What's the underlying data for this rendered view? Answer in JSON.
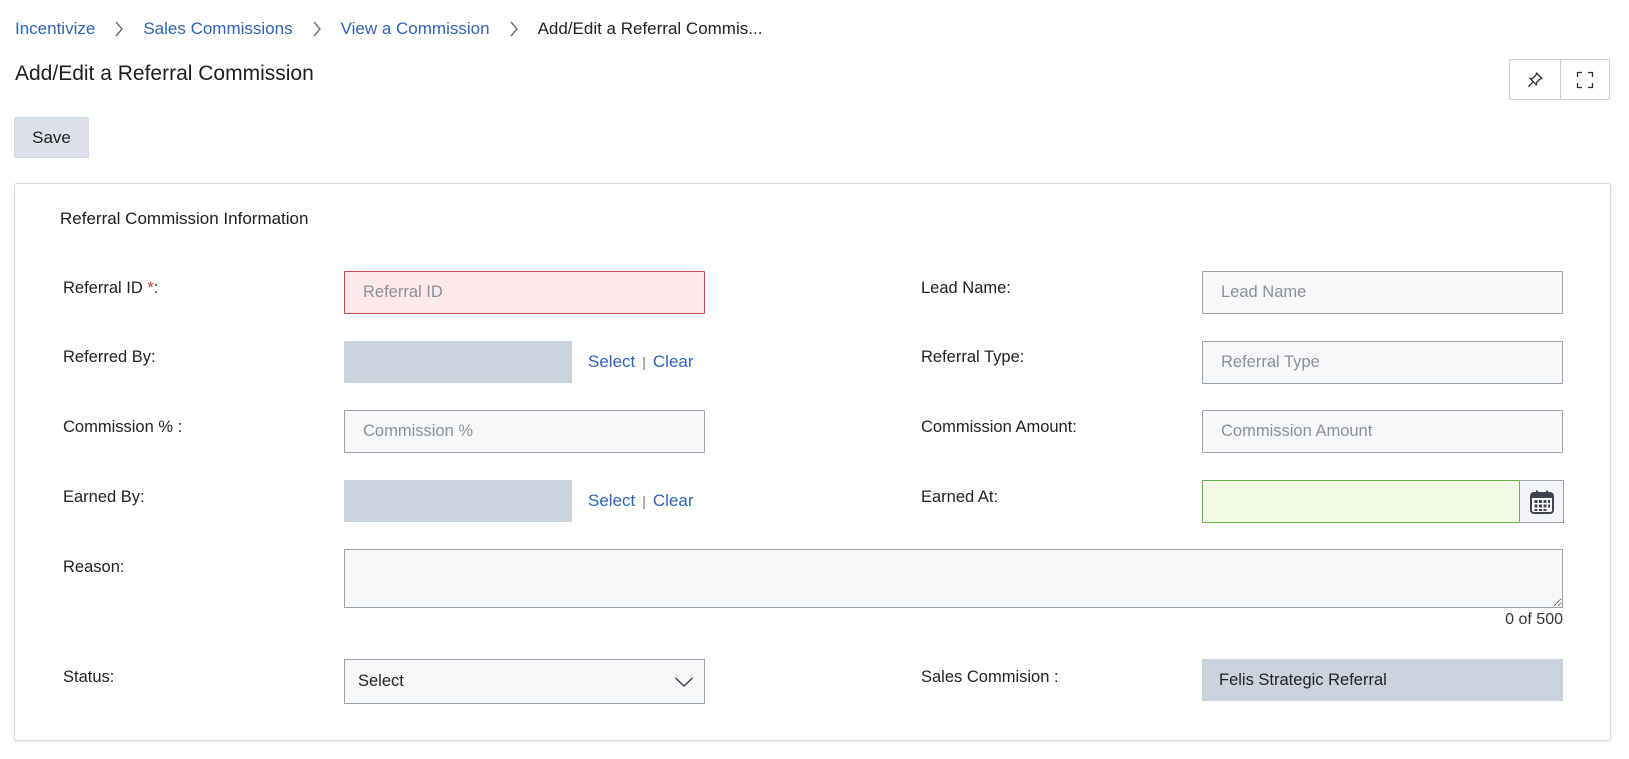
{
  "breadcrumb": {
    "items": [
      "Incentivize",
      "Sales Commissions",
      "View a Commission"
    ],
    "current": "Add/Edit a Referral Commis..."
  },
  "page": {
    "title": "Add/Edit a Referral Commission"
  },
  "toolbar": {
    "save_label": "Save"
  },
  "icons": {
    "pin": "pin-icon",
    "fullscreen": "fullscreen-icon",
    "chevron": "chevron-right-icon",
    "calendar": "calendar-icon",
    "dropdown": "chevron-down-icon"
  },
  "colors": {
    "link": "#2f64b3",
    "error_bg": "#fde9e9",
    "date_bg": "#f3fbe5",
    "lookup_bg": "#cbd3df",
    "save_bg": "#dde2ea"
  },
  "form": {
    "section_title": "Referral Commission Information",
    "referral_id": {
      "label": "Referral ID",
      "required_mark": "*",
      "colon": ":",
      "placeholder": "Referral ID",
      "value": ""
    },
    "lead_name": {
      "label": "Lead Name:",
      "placeholder": "Lead Name",
      "value": ""
    },
    "referred_by": {
      "label": "Referred By:",
      "select": "Select",
      "clear": "Clear",
      "pipe": "|"
    },
    "referral_type": {
      "label": "Referral Type:",
      "placeholder": "Referral Type",
      "value": ""
    },
    "commission_pct": {
      "label": "Commission % :",
      "placeholder": "Commission %",
      "value": ""
    },
    "commission_amount": {
      "label": "Commission Amount:",
      "placeholder": "Commission Amount",
      "value": ""
    },
    "earned_by": {
      "label": "Earned By:",
      "select": "Select",
      "clear": "Clear",
      "pipe": "|"
    },
    "earned_at": {
      "label": "Earned At:",
      "value": ""
    },
    "reason": {
      "label": "Reason:",
      "value": "",
      "char_count": "0 of 500"
    },
    "status": {
      "label": "Status:",
      "value": "Select"
    },
    "sales_commission": {
      "label": "Sales Commision :",
      "value": "Felis Strategic Referral"
    }
  }
}
